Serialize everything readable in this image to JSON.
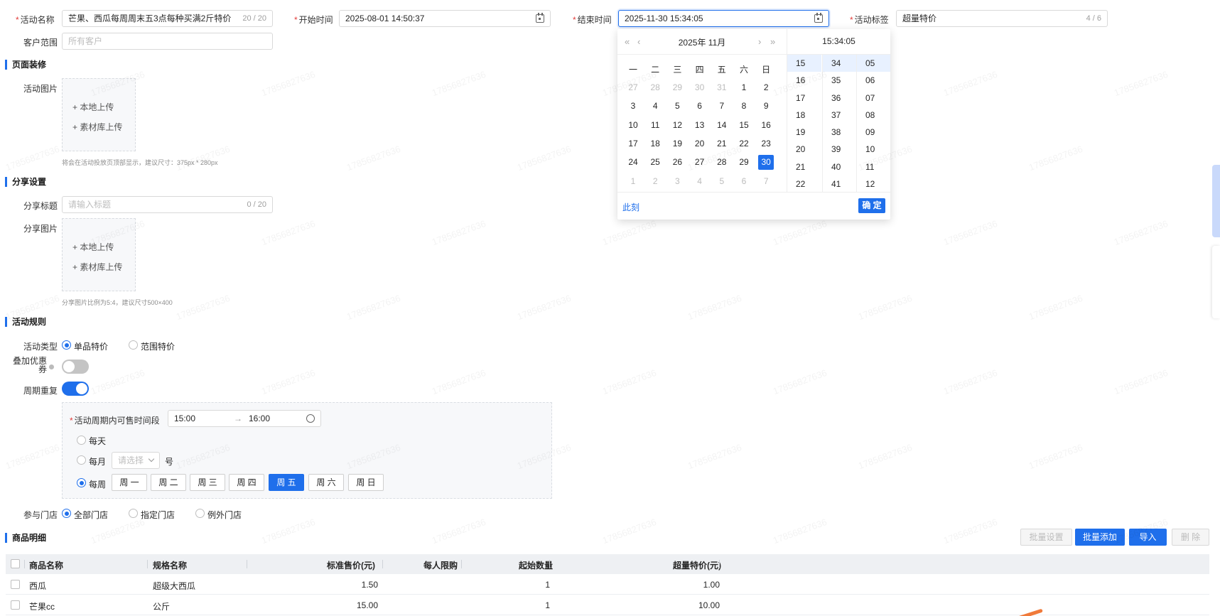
{
  "form": {
    "activity_name_label": "活动名称",
    "activity_name_value": "芒果、西瓜每周周末五3点每种买满2斤特价",
    "activity_name_count": "20 / 20",
    "start_time_label": "开始时间",
    "start_time_value": "2025-08-01 14:50:37",
    "end_time_label": "结束时间",
    "end_time_value": "2025-11-30 15:34:05",
    "tag_label": "活动标签",
    "tag_value": "超量特价",
    "tag_count": "4 / 6",
    "customer_label": "客户范围",
    "customer_placeholder": "所有客户"
  },
  "page_deco": {
    "title": "页面装修",
    "image_label": "活动图片",
    "upload_local": "+ 本地上传",
    "upload_library": "+ 素材库上传",
    "hint": "将会在活动投放页顶部显示，建议尺寸：375px * 280px"
  },
  "share": {
    "title": "分享设置",
    "share_title_label": "分享标题",
    "share_title_placeholder": "请输入标题",
    "share_title_count": "0 / 20",
    "share_image_label": "分享图片",
    "upload_local": "+ 本地上传",
    "upload_library": "+ 素材库上传",
    "hint": "分享图片比例为5:4，建议尺寸500×400"
  },
  "rules": {
    "title": "活动规则",
    "type_label": "活动类型",
    "type_single": "单品特价",
    "type_range": "范围特价",
    "coupon_label": "叠加优惠券",
    "coupon_on": false,
    "repeat_label": "周期重复",
    "repeat_on": true,
    "period_label": "活动周期内可售时间段",
    "period_start": "15:00",
    "period_arrow": "→",
    "period_end": "16:00",
    "daily": "每天",
    "monthly": "每月",
    "monthly_placeholder": "请选择",
    "monthly_suffix": "号",
    "weekly": "每周",
    "weekdays": [
      "周 一",
      "周 二",
      "周 三",
      "周 四",
      "周 五",
      "周 六",
      "周 日"
    ],
    "weekday_selected": "周 五",
    "stores_label": "参与门店",
    "stores_all": "全部门店",
    "stores_specified": "指定门店",
    "stores_except": "例外门店"
  },
  "products": {
    "title": "商品明细",
    "buttons": {
      "batch_setting": "批量设置",
      "batch_add": "批量添加",
      "import": "导入",
      "delete": "删 除"
    },
    "columns": [
      "商品名称",
      "规格名称",
      "标准售价(元)",
      "每人限购",
      "起始数量",
      "超量特价(元)"
    ],
    "rows": [
      [
        "西瓜",
        "超级大西瓜",
        "1.50",
        "",
        "1",
        "1.00"
      ],
      [
        "芒果cc",
        "公斤",
        "15.00",
        "",
        "1",
        "10.00"
      ]
    ]
  },
  "picker": {
    "year_month": "2025年  11月",
    "nav_prev_year": "«",
    "nav_prev_month": "‹",
    "nav_next_month": "›",
    "nav_next_year": "»",
    "weekdays": [
      "一",
      "二",
      "三",
      "四",
      "五",
      "六",
      "日"
    ],
    "days": [
      [
        "27",
        "28",
        "29",
        "30",
        "31",
        "1",
        "2"
      ],
      [
        "3",
        "4",
        "5",
        "6",
        "7",
        "8",
        "9"
      ],
      [
        "10",
        "11",
        "12",
        "13",
        "14",
        "15",
        "16"
      ],
      [
        "17",
        "18",
        "19",
        "20",
        "21",
        "22",
        "23"
      ],
      [
        "24",
        "25",
        "26",
        "27",
        "28",
        "29",
        "30"
      ],
      [
        "1",
        "2",
        "3",
        "4",
        "5",
        "6",
        "7"
      ]
    ],
    "selected_day": "30",
    "time_display": "15:34:05",
    "hours": [
      "15",
      "16",
      "17",
      "18",
      "19",
      "20",
      "21",
      "22"
    ],
    "minutes": [
      "34",
      "35",
      "36",
      "37",
      "38",
      "39",
      "40",
      "41"
    ],
    "seconds": [
      "05",
      "06",
      "07",
      "08",
      "09",
      "10",
      "11",
      "12"
    ],
    "now_label": "此刻",
    "confirm_label": "确 定"
  },
  "watermark": "17856827636"
}
